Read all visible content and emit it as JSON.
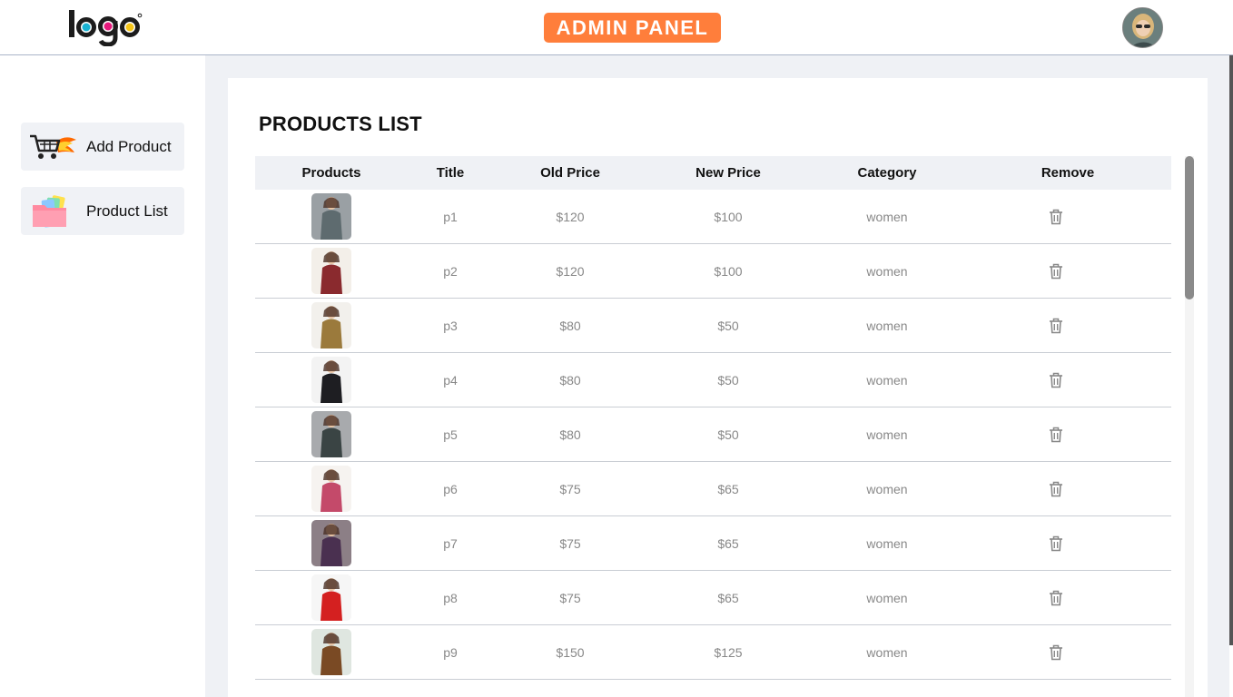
{
  "header": {
    "logo_text": "logo",
    "badge": "ADMIN PANEL",
    "badge_color": "#ff7e3b"
  },
  "sidebar": {
    "items": [
      {
        "label": "Add Product",
        "icon": "cart-icon"
      },
      {
        "label": "Product List",
        "icon": "folders-icon"
      }
    ]
  },
  "main": {
    "title": "PRODUCTS LIST",
    "columns": [
      "Products",
      "Title",
      "Old Price",
      "New Price",
      "Category",
      "Remove"
    ],
    "rows": [
      {
        "title": "p1",
        "old_price": "$120",
        "new_price": "$100",
        "category": "women"
      },
      {
        "title": "p2",
        "old_price": "$120",
        "new_price": "$100",
        "category": "women"
      },
      {
        "title": "p3",
        "old_price": "$80",
        "new_price": "$50",
        "category": "women"
      },
      {
        "title": "p4",
        "old_price": "$80",
        "new_price": "$50",
        "category": "women"
      },
      {
        "title": "p5",
        "old_price": "$80",
        "new_price": "$50",
        "category": "women"
      },
      {
        "title": "p6",
        "old_price": "$75",
        "new_price": "$65",
        "category": "women"
      },
      {
        "title": "p7",
        "old_price": "$75",
        "new_price": "$65",
        "category": "women"
      },
      {
        "title": "p8",
        "old_price": "$75",
        "new_price": "$65",
        "category": "women"
      },
      {
        "title": "p9",
        "old_price": "$150",
        "new_price": "$125",
        "category": "women"
      }
    ]
  }
}
